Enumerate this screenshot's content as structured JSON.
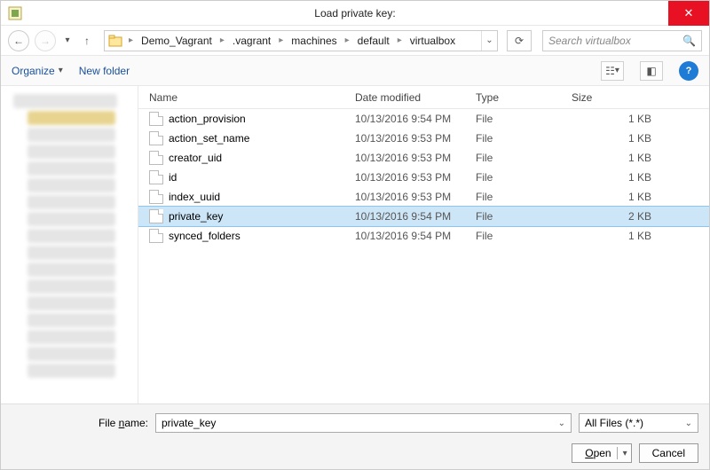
{
  "window": {
    "title": "Load private key:"
  },
  "nav": {
    "breadcrumb": [
      "Demo_Vagrant",
      ".vagrant",
      "machines",
      "default",
      "virtualbox"
    ],
    "search_placeholder": "Search virtualbox"
  },
  "toolbar": {
    "organize": "Organize",
    "new_folder": "New folder"
  },
  "columns": {
    "name": "Name",
    "date": "Date modified",
    "type": "Type",
    "size": "Size"
  },
  "files": [
    {
      "name": "action_provision",
      "date": "10/13/2016 9:54 PM",
      "type": "File",
      "size": "1 KB",
      "selected": false
    },
    {
      "name": "action_set_name",
      "date": "10/13/2016 9:53 PM",
      "type": "File",
      "size": "1 KB",
      "selected": false
    },
    {
      "name": "creator_uid",
      "date": "10/13/2016 9:53 PM",
      "type": "File",
      "size": "1 KB",
      "selected": false
    },
    {
      "name": "id",
      "date": "10/13/2016 9:53 PM",
      "type": "File",
      "size": "1 KB",
      "selected": false
    },
    {
      "name": "index_uuid",
      "date": "10/13/2016 9:53 PM",
      "type": "File",
      "size": "1 KB",
      "selected": false
    },
    {
      "name": "private_key",
      "date": "10/13/2016 9:54 PM",
      "type": "File",
      "size": "2 KB",
      "selected": true
    },
    {
      "name": "synced_folders",
      "date": "10/13/2016 9:54 PM",
      "type": "File",
      "size": "1 KB",
      "selected": false
    }
  ],
  "footer": {
    "filename_label": "File name:",
    "filename_value": "private_key",
    "filter": "All Files (*.*)",
    "open": "Open",
    "cancel": "Cancel"
  }
}
